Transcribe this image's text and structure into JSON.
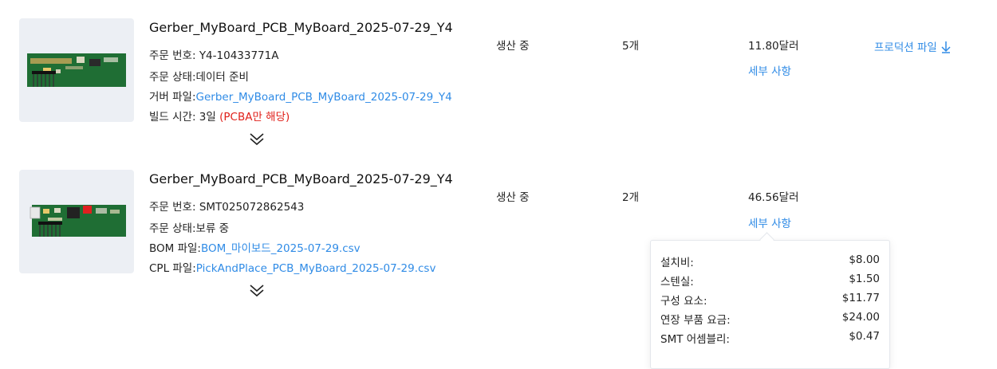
{
  "orders": [
    {
      "title": "Gerber_MyBoard_PCB_MyBoard_2025-07-29_Y4",
      "order_no_label": "주문 번호: ",
      "order_no": "Y4-10433771A",
      "order_status_label": "주문 상태:",
      "order_status": "데이터 준비",
      "file_label": "거버 파일:",
      "file_link": "Gerber_MyBoard_PCB_MyBoard_2025-07-29_Y4",
      "build_label": "빌드 시간: 3일 ",
      "build_note": "(PCBA만 해당)",
      "status": "생산 중",
      "quantity": "5개",
      "price": "11.80달러",
      "details_label": "세부 사항",
      "production_file_label": "프로덕션 파일"
    },
    {
      "title": "Gerber_MyBoard_PCB_MyBoard_2025-07-29_Y4",
      "order_no_label": "주문 번호: ",
      "order_no": "SMT025072862543",
      "order_status_label": "주문 상태:",
      "order_status": "보류 중",
      "bom_label": "BOM 파일:",
      "bom_link": "BOM_마이보드_2025-07-29.csv",
      "cpl_label": "CPL 파일:",
      "cpl_link": "PickAndPlace_PCB_MyBoard_2025-07-29.csv",
      "status": "생산 중",
      "quantity": "2개",
      "price": "46.56달러",
      "details_label": "세부 사항"
    }
  ],
  "price_popup": {
    "rows": [
      {
        "label": "설치비:",
        "value": "$8.00"
      },
      {
        "label": "스텐실:",
        "value": "$1.50"
      },
      {
        "label": "구성 요소:",
        "value": "$11.77"
      },
      {
        "label": "연장 부품 요금:",
        "value": "$24.00"
      },
      {
        "label": "SMT 어셈블리:",
        "value": "$0.47"
      }
    ]
  },
  "colors": {
    "link": "#2f8be6",
    "warning": "#e0201a",
    "thumb_bg": "#eceff4",
    "pcb_green": "#1f6e34"
  },
  "icons": [
    "chevron-double-down-icon",
    "download-arrow-icon"
  ]
}
